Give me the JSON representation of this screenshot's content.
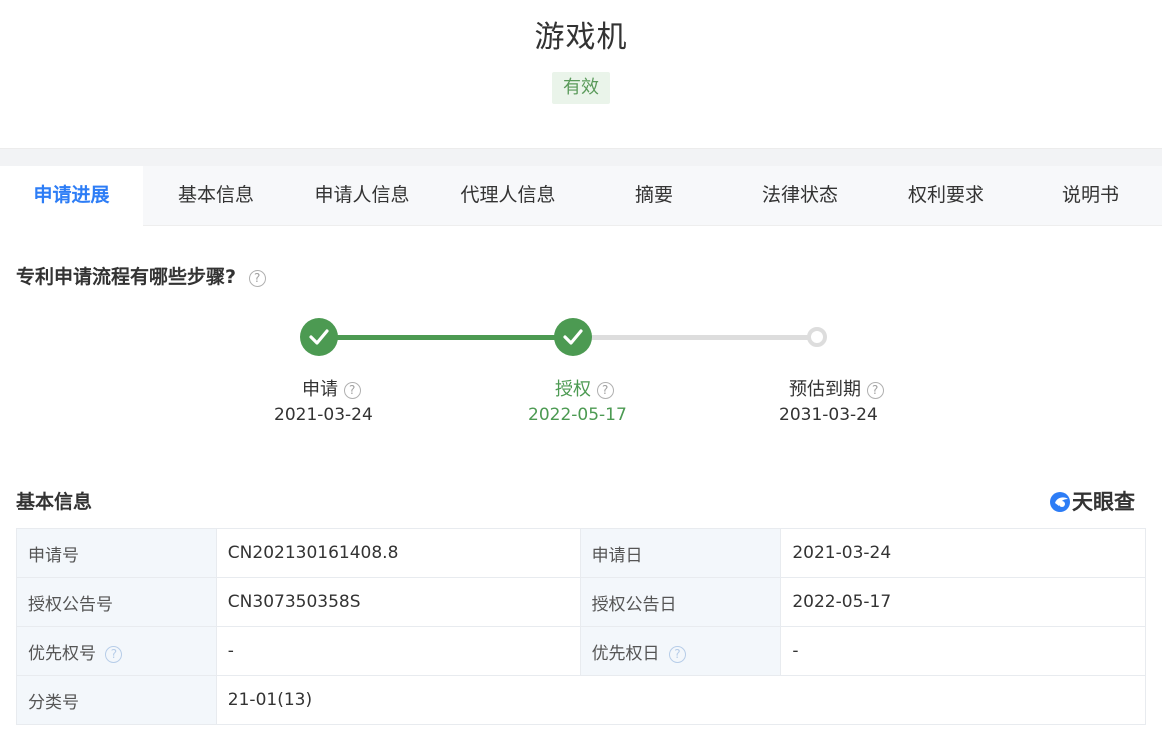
{
  "header": {
    "title": "游戏机",
    "status": "有效"
  },
  "tabs": [
    {
      "label": "申请进展"
    },
    {
      "label": "基本信息"
    },
    {
      "label": "申请人信息"
    },
    {
      "label": "代理人信息"
    },
    {
      "label": "摘要"
    },
    {
      "label": "法律状态"
    },
    {
      "label": "权利要求"
    },
    {
      "label": "说明书"
    }
  ],
  "progress": {
    "title": "专利申请流程有哪些步骤?",
    "help_glyph": "?",
    "steps": [
      {
        "label": "申请",
        "date": "2021-03-24",
        "state": "done"
      },
      {
        "label": "授权",
        "date": "2022-05-17",
        "state": "current"
      },
      {
        "label": "预估到期",
        "date": "2031-03-24",
        "state": "pending"
      }
    ],
    "colors": {
      "done": "#4c9a52",
      "pending": "#dddddd"
    }
  },
  "basic_info": {
    "title": "基本信息",
    "brand": "天眼查",
    "rows": [
      {
        "k1": "申请号",
        "v1": "CN202130161408.8",
        "k2": "申请日",
        "v2": "2021-03-24"
      },
      {
        "k1": "授权公告号",
        "v1": "CN307350358S",
        "k2": "授权公告日",
        "v2": "2022-05-17"
      },
      {
        "k1": "优先权号",
        "v1": "-",
        "k2": "优先权日",
        "v2": "-"
      },
      {
        "k1": "分类号",
        "v1": "21-01(13)"
      }
    ]
  },
  "colors": {
    "accent": "#2d7df6",
    "success": "#4c9a52",
    "status_bg": "#eaf4ea"
  }
}
